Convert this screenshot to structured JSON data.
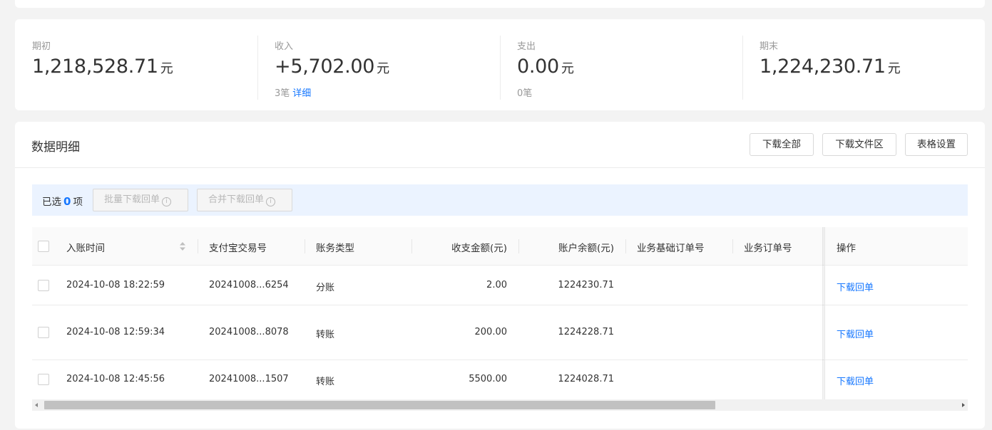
{
  "summary": {
    "unit": "元",
    "opening": {
      "label": "期初",
      "amount": "1,218,528.71"
    },
    "income": {
      "label": "收入",
      "amount": "+5,702.00",
      "count": "3笔",
      "detail_link": "详细"
    },
    "expense": {
      "label": "支出",
      "amount": "0.00",
      "count": "0笔"
    },
    "closing": {
      "label": "期末",
      "amount": "1,224,230.71"
    }
  },
  "detail": {
    "title": "数据明细",
    "buttons": {
      "download_all": "下载全部",
      "download_files": "下载文件区",
      "table_settings": "表格设置"
    },
    "selection": {
      "prefix": "已选",
      "count": "0",
      "suffix": "项"
    },
    "batch_download": "批量下载回单",
    "merge_download": "合并下载回单",
    "info_icon": "i",
    "columns": [
      "入账时间",
      "支付宝交易号",
      "账务类型",
      "收支金额(元)",
      "账户余额(元)",
      "业务基础订单号",
      "业务订单号",
      "操作"
    ],
    "rows": [
      {
        "time": "2024-10-08 18:22:59",
        "trade_no": "20241008...6254",
        "type": "分账",
        "amount": "2.00",
        "balance": "1224230.71",
        "base_order": "",
        "order": "",
        "action": "下载回单"
      },
      {
        "time": "2024-10-08 12:59:34",
        "trade_no": "20241008...8078",
        "type": "转账",
        "amount": "200.00",
        "balance": "1224228.71",
        "base_order": "",
        "order": "",
        "action": "下载回单"
      },
      {
        "time": "2024-10-08 12:45:56",
        "trade_no": "20241008...1507",
        "type": "转账",
        "amount": "5500.00",
        "balance": "1224028.71",
        "base_order": "",
        "order": "",
        "action": "下载回单"
      }
    ]
  },
  "colors": {
    "accent": "#1677ff",
    "background": "#f3f3f3",
    "selection_bar": "#ebf3ff"
  }
}
